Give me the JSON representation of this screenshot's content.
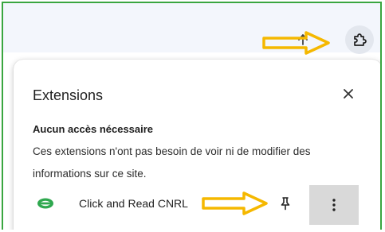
{
  "toolbar": {
    "up_icon": "up-arrow-icon",
    "extensions_icon": "puzzle-piece-icon"
  },
  "panel": {
    "title": "Extensions",
    "close_icon": "close-icon",
    "section_title": "Aucun accès nécessaire",
    "section_description": "Ces extensions n'ont pas besoin de voir ni de modifier des informations sur ce site.",
    "extensions": [
      {
        "name": "Click and Read CNRL",
        "icon": "click-and-read-logo",
        "pin_icon": "pin-icon",
        "menu_icon": "more-vert-icon"
      }
    ]
  },
  "annotations": {
    "arrow_color": "#f5b800",
    "items": [
      "annotation-arrow-toolbar",
      "annotation-arrow-pin"
    ]
  },
  "colors": {
    "frame_border": "#3aa640",
    "toolbar_bg": "#f3f6fc",
    "menu_button_bg": "#d9d9d9"
  }
}
